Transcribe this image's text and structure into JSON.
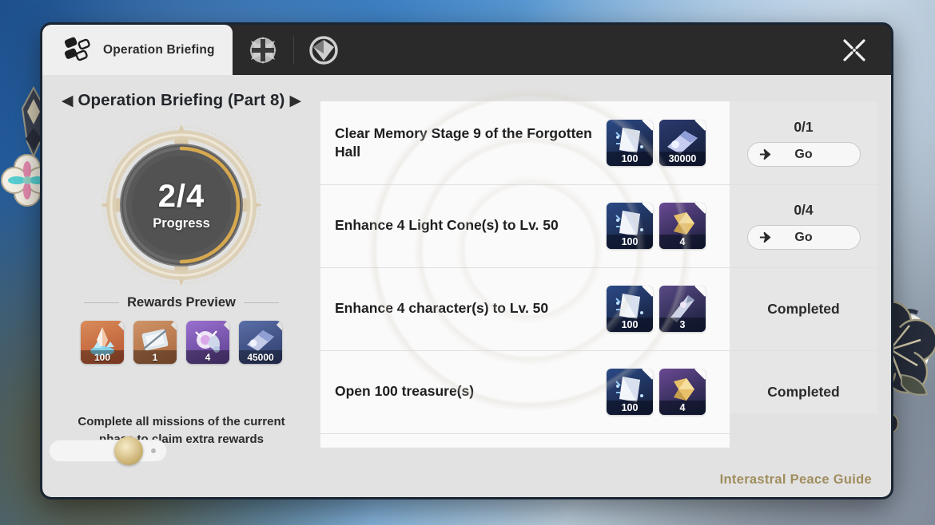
{
  "window": {
    "close_icon": "close-x-icon",
    "tabs": [
      {
        "label": "Operation Briefing",
        "icon": "operation-briefing-icon",
        "active": true
      },
      {
        "label": "",
        "icon": "compass-emblem-icon",
        "active": false
      },
      {
        "label": "",
        "icon": "dart-emblem-icon",
        "active": false
      }
    ]
  },
  "sidebar": {
    "breadcrumb": {
      "prev_icon": "triangle-left-icon",
      "title": "Operation Briefing (Part 8)",
      "next_icon": "triangle-right-icon"
    },
    "progress": {
      "current": 2,
      "total": 4,
      "fraction": "2/4",
      "label": "Progress",
      "percent": 50,
      "ring_color": "#d6a84f"
    },
    "rewards_preview": {
      "heading": "Rewards Preview",
      "items": [
        {
          "name": "stellar-jade-item",
          "count": "100",
          "color": "#c9693f"
        },
        {
          "name": "star-rail-pass-item",
          "count": "1",
          "color": "#c07a4a"
        },
        {
          "name": "purple-relic-item",
          "count": "4",
          "color": "#7a53a8"
        },
        {
          "name": "credit-item",
          "count": "45000",
          "color": "#3a4f82"
        }
      ]
    },
    "footer_note": "Complete all missions of the current phase to claim extra rewards",
    "bottom_control": {
      "name": "progress-slider",
      "knob": "gold-knob-icon"
    }
  },
  "missions": [
    {
      "title": "Clear Memory Stage 9 of the Forgotten Hall",
      "rewards": [
        {
          "name": "trailblaze-exp-item",
          "count": "100",
          "color": "#2c4a86"
        },
        {
          "name": "credit-item",
          "count": "30000",
          "color": "#2a3a6e"
        }
      ],
      "status_type": "progress",
      "status_text": "0/1",
      "action_label": "Go",
      "action_icon": "arrow-right-icon"
    },
    {
      "title": "Enhance 4 Light Cone(s) to Lv. 50",
      "rewards": [
        {
          "name": "trailblaze-exp-item",
          "count": "100",
          "color": "#2c4a86"
        },
        {
          "name": "light-cone-material-item",
          "count": "4",
          "color": "#6a4a94"
        }
      ],
      "status_type": "progress",
      "status_text": "0/4",
      "action_label": "Go",
      "action_icon": "arrow-right-icon"
    },
    {
      "title": "Enhance 4 character(s) to Lv. 50",
      "rewards": [
        {
          "name": "trailblaze-exp-item",
          "count": "100",
          "color": "#2c4a86"
        },
        {
          "name": "character-material-item",
          "count": "3",
          "color": "#5a4a86"
        }
      ],
      "status_type": "completed",
      "status_text": "Completed",
      "action_label": "",
      "action_icon": ""
    },
    {
      "title": "Open 100 treasure(s)",
      "rewards": [
        {
          "name": "trailblaze-exp-item",
          "count": "100",
          "color": "#2c4a86"
        },
        {
          "name": "light-cone-material-item",
          "count": "4",
          "color": "#6a4a94"
        }
      ],
      "status_type": "completed",
      "status_text": "Completed",
      "action_label": "",
      "action_icon": ""
    }
  ],
  "watermark": "Interastral Peace Guide",
  "ornaments": {
    "left": "flower-ornament-icon",
    "right": "dark-flower-ornament-icon",
    "mascot": "pom-pom-mascot-icon"
  }
}
